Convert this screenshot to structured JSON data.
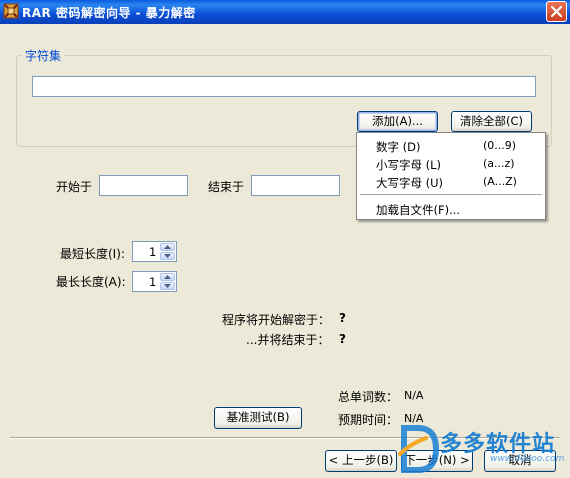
{
  "window": {
    "title": "RAR 密码解密向导 - 暴力解密"
  },
  "charset_group": {
    "legend": "字符集",
    "input_value": "",
    "add_button": "添加(A)...",
    "clear_all_button": "清除全部(C)"
  },
  "add_menu": {
    "items": [
      {
        "label": "数字 (D)",
        "range": "(0...9)"
      },
      {
        "label": "小写字母 (L)",
        "range": "(a...z)"
      },
      {
        "label": "大写字母 (U)",
        "range": "(A...Z)"
      }
    ],
    "load_from_file": "加载自文件(F)..."
  },
  "range": {
    "start_label": "开始于",
    "start_value": "",
    "end_label": "结束于",
    "end_value": ""
  },
  "length": {
    "min_label": "最短长度(I):",
    "min_value": "1",
    "max_label": "最长长度(A):",
    "max_value": "1"
  },
  "info": {
    "start_decrypt_label": "程序将开始解密于：",
    "start_decrypt_value": "?",
    "end_decrypt_label": "...并将结束于：",
    "end_decrypt_value": "?",
    "total_words_label": "总单词数：",
    "total_words_value": "N/A",
    "estimated_time_label": "预期时间：",
    "estimated_time_value": "N/A"
  },
  "benchmark_button": "基准测试(B)",
  "nav": {
    "back_button": "< 上一步(B)",
    "next_button": "下一步(N) >",
    "cancel_button": "取消"
  },
  "watermark": {
    "text": "多多软件站",
    "sub": "www.ddooo.com"
  },
  "colors": {
    "title_bar": "#0a4fd6",
    "group_legend": "#0046d5",
    "window_bg": "#ece9d8"
  }
}
